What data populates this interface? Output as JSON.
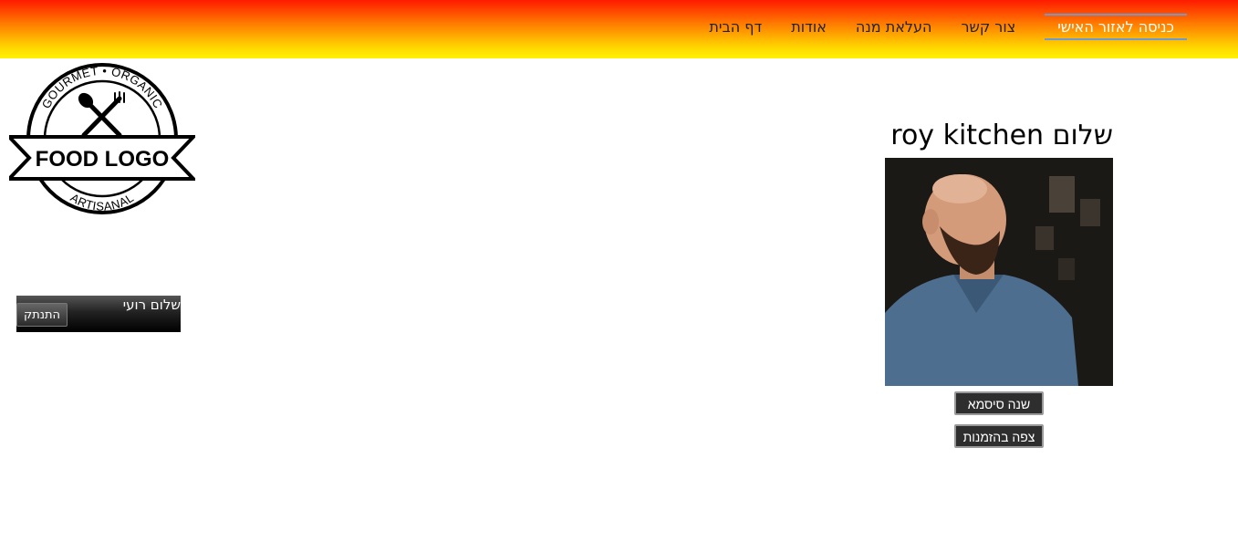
{
  "nav": {
    "items": [
      {
        "label": "דף הבית"
      },
      {
        "label": "אודות"
      },
      {
        "label": "העלאת מנה"
      },
      {
        "label": "צור קשר"
      },
      {
        "label": "כניסה לאזור האישי"
      }
    ]
  },
  "logo": {
    "top_text": "GOURMET • ORGANIC",
    "main_text": "FOOD LOGO",
    "bottom_text": "ARTISANAL"
  },
  "user_box": {
    "greeting": "שלום רועי",
    "logout_label": "התנתק"
  },
  "profile": {
    "title": "שלום roy kitchen",
    "change_password_label": "שנה סיסמא",
    "view_orders_label": "צפה בהזמנות"
  },
  "colors": {
    "header_top": "#ff1a00",
    "header_bottom": "#fff200",
    "active_border": "#6a9bd8",
    "button_bg": "#2e2e2e"
  }
}
